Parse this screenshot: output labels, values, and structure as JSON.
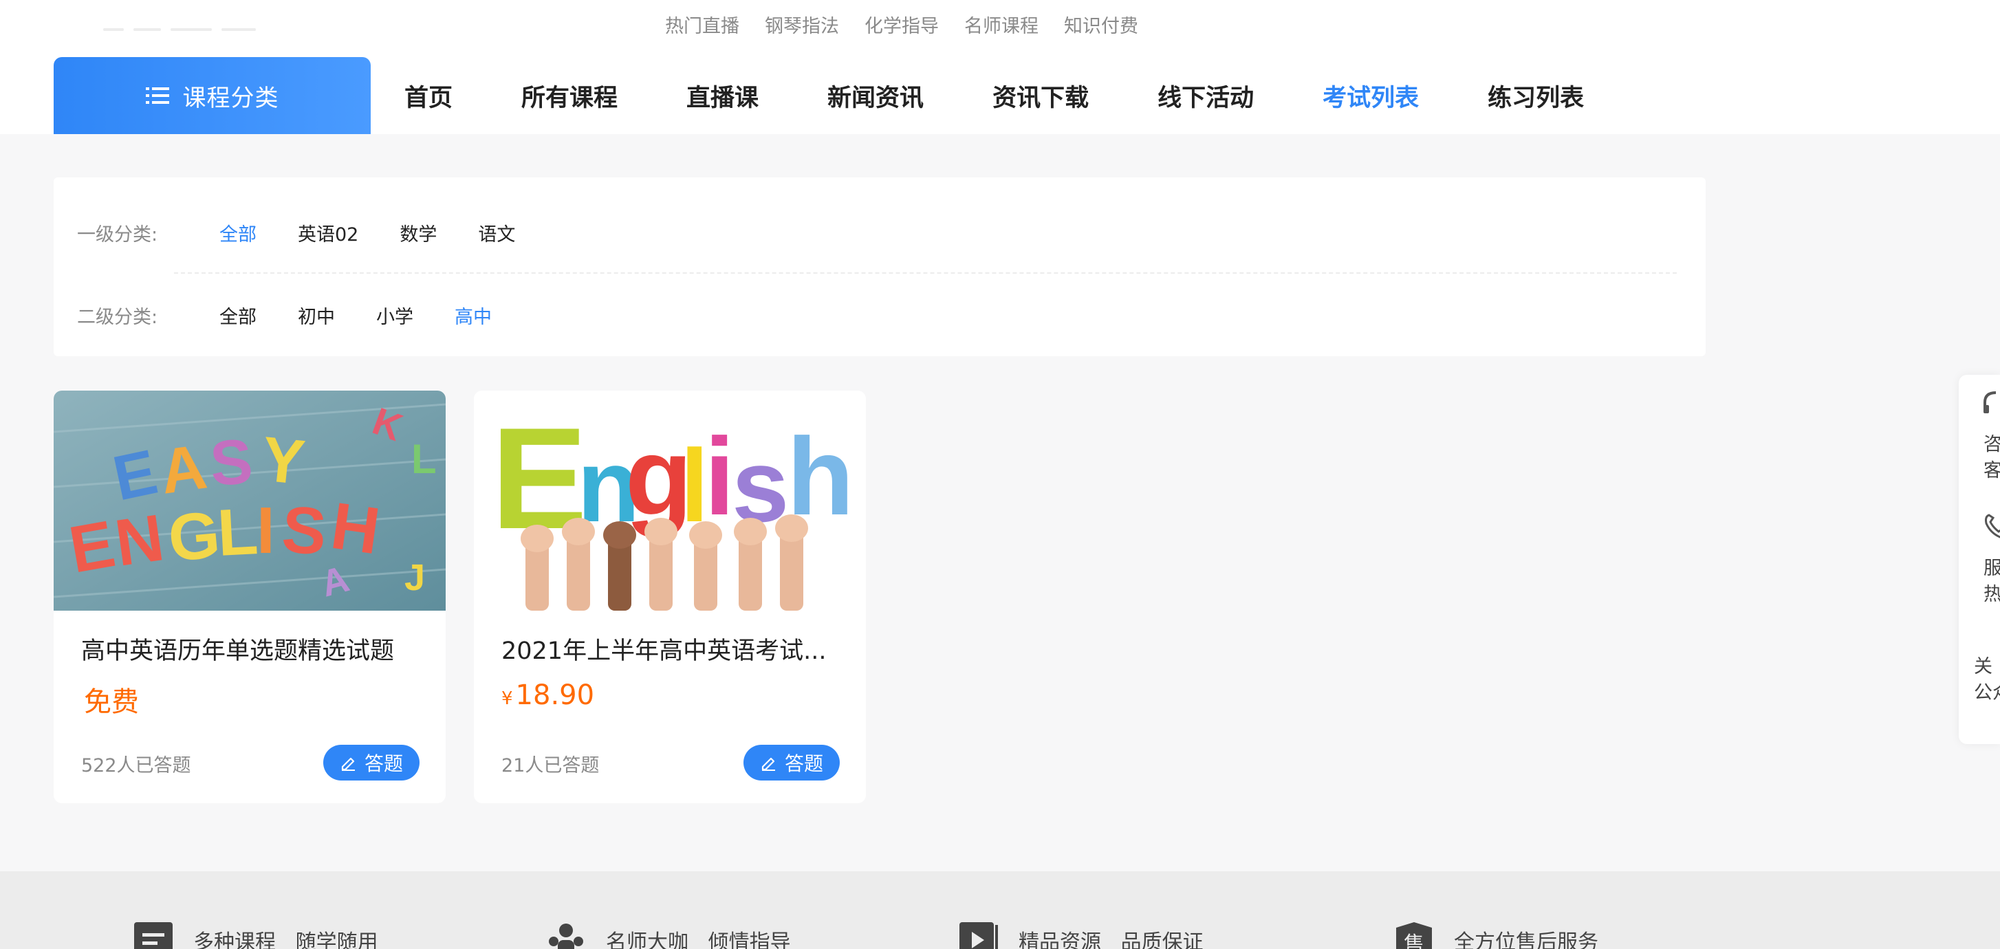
{
  "header": {
    "hot_links": [
      "热门直播",
      "钢琴指法",
      "化学指导",
      "名师课程",
      "知识付费"
    ],
    "category_button": "课程分类",
    "nav": [
      {
        "label": "首页",
        "active": false
      },
      {
        "label": "所有课程",
        "active": false
      },
      {
        "label": "直播课",
        "active": false
      },
      {
        "label": "新闻资讯",
        "active": false
      },
      {
        "label": "资讯下载",
        "active": false
      },
      {
        "label": "线下活动",
        "active": false
      },
      {
        "label": "考试列表",
        "active": true
      },
      {
        "label": "练习列表",
        "active": false
      }
    ]
  },
  "filters": {
    "level1": {
      "label": "一级分类:",
      "options": [
        "全部",
        "英语02",
        "数学",
        "语文"
      ],
      "active": "全部"
    },
    "level2": {
      "label": "二级分类:",
      "options": [
        "全部",
        "初中",
        "小学",
        "高中"
      ],
      "active": "高中"
    }
  },
  "cards": [
    {
      "title": "高中英语历年单选题精选试题",
      "price": "免费",
      "currency": "",
      "count": "522人已答题",
      "button": "答题",
      "image_text": "EASY ENGLISH"
    },
    {
      "title": "2021年上半年高中英语考试...",
      "price": "18.90",
      "currency": "¥",
      "count": "21人已答题",
      "button": "答题",
      "image_text": "English"
    }
  ],
  "float_bar": {
    "items": [
      {
        "icon": "headset-icon",
        "text": [
          "咨",
          "客"
        ]
      },
      {
        "icon": "phone-icon",
        "text": [
          "服",
          "热"
        ]
      },
      {
        "icon": "",
        "text": [
          "关",
          "公众"
        ]
      }
    ]
  },
  "footer": {
    "features": [
      {
        "icon": "list-icon",
        "text": "多种课程   随学随用"
      },
      {
        "icon": "teacher-icon",
        "text": "名师大咖   倾情指导"
      },
      {
        "icon": "play-icon",
        "text": "精品资源   品质保证"
      },
      {
        "icon": "sale-icon",
        "text": "全方位售后服务"
      }
    ],
    "sale_glyph": "售"
  },
  "colors": {
    "accent": "#2f86f7",
    "price": "#ff6a00",
    "muted": "#8a8a8a",
    "page_bg": "#f7f7f8",
    "footer_bg": "#ececec"
  }
}
